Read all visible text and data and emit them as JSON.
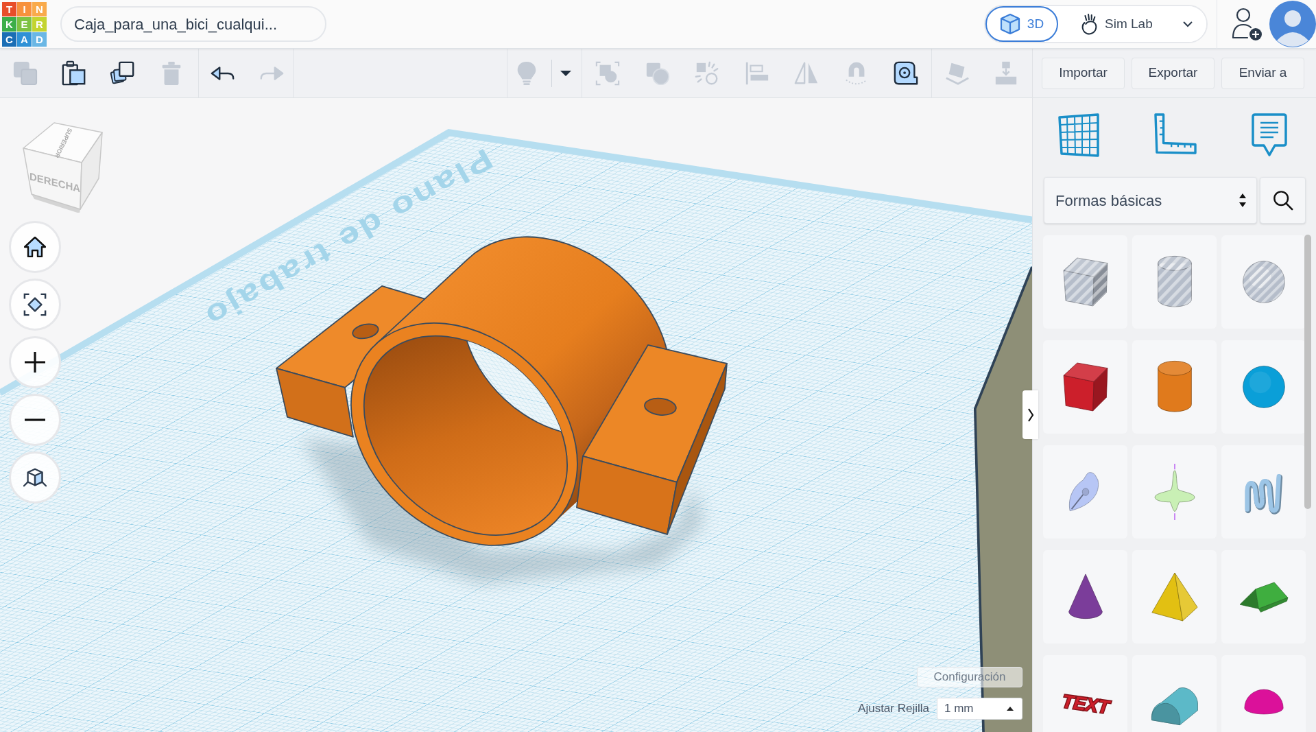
{
  "header": {
    "logo": [
      {
        "letter": "T",
        "color": "#e84e2a"
      },
      {
        "letter": "I",
        "color": "#f7913d"
      },
      {
        "letter": "N",
        "color": "#f9aa4b"
      },
      {
        "letter": "K",
        "color": "#3cae49"
      },
      {
        "letter": "E",
        "color": "#7dc242"
      },
      {
        "letter": "R",
        "color": "#c3d430"
      },
      {
        "letter": "C",
        "color": "#1b6eb5"
      },
      {
        "letter": "A",
        "color": "#2f91d6"
      },
      {
        "letter": "D",
        "color": "#6ab7e5"
      }
    ],
    "design_title": "Caja_para_una_bici_cualqui...",
    "modes": [
      {
        "kind": "design",
        "label": "3D",
        "selected": true
      },
      {
        "kind": "simulation",
        "label": "Sim Lab",
        "selected": false
      }
    ]
  },
  "toolbar": {
    "groups": [
      {
        "tools": [
          {
            "kind": "copy",
            "disabled": true
          },
          {
            "kind": "paste",
            "disabled": false
          },
          {
            "kind": "duplicate",
            "disabled": false
          },
          {
            "kind": "delete",
            "disabled": true
          }
        ]
      },
      {
        "tools": [
          {
            "kind": "undo",
            "disabled": false
          },
          {
            "kind": "redo",
            "disabled": true
          }
        ]
      },
      {
        "tools": [
          {
            "kind": "bulb",
            "disabled": true
          },
          {
            "kind": "bulb-menu",
            "disabled": false
          }
        ]
      },
      {
        "tools": [
          {
            "kind": "group",
            "disabled": true
          },
          {
            "kind": "combine",
            "disabled": true
          },
          {
            "kind": "cruise",
            "disabled": true
          },
          {
            "kind": "align",
            "disabled": true
          },
          {
            "kind": "mirror",
            "disabled": true
          },
          {
            "kind": "magnet",
            "disabled": true
          },
          {
            "kind": "ruler",
            "disabled": false
          }
        ]
      },
      {
        "tools": [
          {
            "kind": "workplane",
            "disabled": true
          },
          {
            "kind": "drop",
            "disabled": true
          }
        ]
      }
    ],
    "actions": [
      "Importar",
      "Exportar",
      "Enviar a"
    ]
  },
  "viewport": {
    "view_cube": {
      "top": "SUPERIOR",
      "front": "DERECHA"
    },
    "workplane_label": "Plano de trabajo",
    "nav_buttons": [
      {
        "kind": "home"
      },
      {
        "kind": "fit"
      },
      {
        "kind": "zoom-in"
      },
      {
        "kind": "zoom-out"
      },
      {
        "kind": "projection"
      }
    ],
    "settings_button": "Configuración",
    "snap_grid": {
      "label": "Ajustar Rejilla",
      "value": "1 mm"
    }
  },
  "shapes_panel": {
    "tabs": [
      {
        "kind": "grid"
      },
      {
        "kind": "ruler"
      },
      {
        "kind": "notes"
      }
    ],
    "category": "Formas básicas",
    "shapes": [
      {
        "kind": "box-hole"
      },
      {
        "kind": "cylinder-hole"
      },
      {
        "kind": "sphere-hole"
      },
      {
        "kind": "box"
      },
      {
        "kind": "cylinder"
      },
      {
        "kind": "sphere"
      },
      {
        "kind": "scribble"
      },
      {
        "kind": "spinner"
      },
      {
        "kind": "squiggle"
      },
      {
        "kind": "cone"
      },
      {
        "kind": "pyramid"
      },
      {
        "kind": "roof"
      },
      {
        "kind": "text",
        "label": "TEXT"
      },
      {
        "kind": "half-cylinder"
      },
      {
        "kind": "dome"
      }
    ]
  }
}
